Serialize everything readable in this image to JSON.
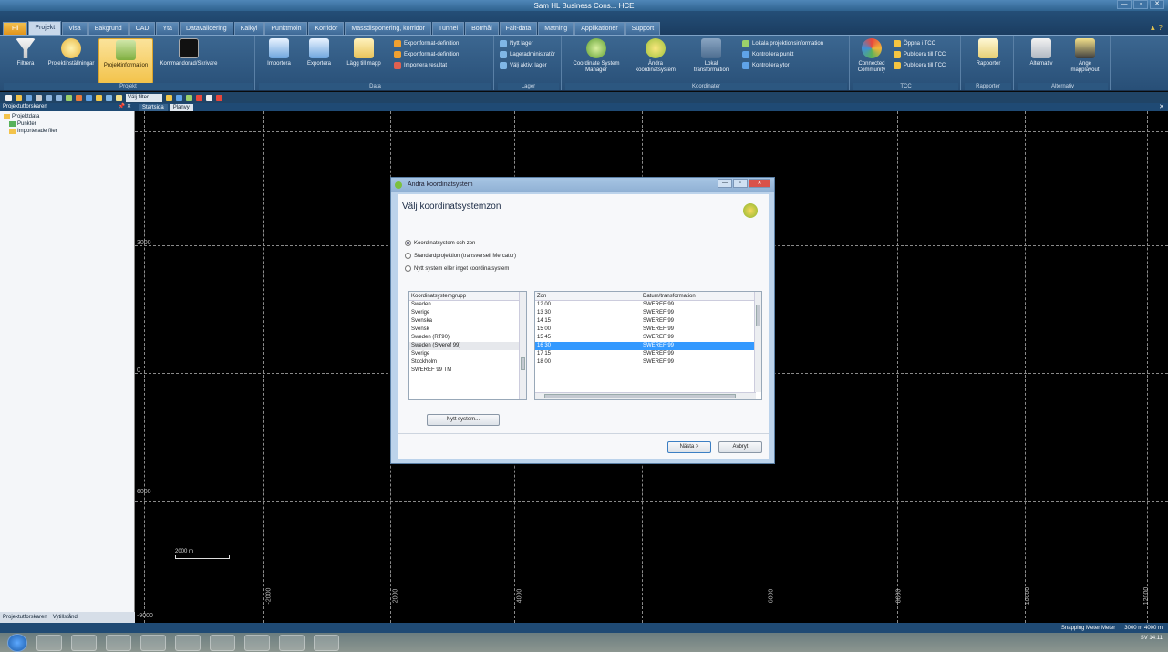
{
  "window": {
    "title": "Sam HL  Business Cons...  HCE",
    "minimize": "—",
    "maximize": "▫",
    "close": "✕"
  },
  "tabs": [
    "Fil",
    "Projekt",
    "Visa",
    "Bakgrund",
    "CAD",
    "Yta",
    "Datavalidering",
    "Kalkyl",
    "Punktmoln",
    "Korridor",
    "Massdisponering, korridor",
    "Tunnel",
    "Borrhål",
    "Fält-data",
    "Mätning",
    "Applikationer",
    "Support"
  ],
  "tabs_right": "▲  ?",
  "ribbon": {
    "groups": [
      {
        "label": "Projekt",
        "big": [
          "Filtrera",
          "Projektinställningar",
          "Projektinformation",
          "Kommandorad/Skrivare"
        ]
      },
      {
        "label": "Data",
        "big": [
          "Importera",
          "Exportera",
          "Lägg till mapp"
        ],
        "small": [
          "Exportformat-definition",
          "Exportformat-definition",
          "Importera resultat"
        ]
      },
      {
        "label": "Lager",
        "small": [
          "Nytt lager",
          "Lageradministratör",
          "Välj aktivt lager"
        ]
      },
      {
        "label": "Koordinater",
        "big": [
          "Coordinate System Manager",
          "Ändra koordinatsystem",
          "Lokal transformation"
        ],
        "small": [
          "Lokala projektionsinformation",
          "Kontrollera punkt",
          "Kontrollera ytor"
        ]
      },
      {
        "label": "TCC",
        "big": [
          "Connected Community"
        ],
        "small": [
          "Öppna i TCC",
          "Publicera till TCC",
          "Publicera till TCC"
        ]
      },
      {
        "label": "Rapporter",
        "big": [
          "Rapporter"
        ]
      },
      {
        "label": "Alternativ",
        "big": [
          "Alternativ",
          "Ange mapplayout"
        ]
      }
    ]
  },
  "qat": {
    "filter_label": "Välj filter"
  },
  "left_panel": {
    "title": "Projektutforskaren",
    "pin": "📌 ✕",
    "tree": [
      "Projektdata",
      "Punkter",
      "Importerade filer"
    ],
    "bottom_tabs": [
      "Projektutforskaren",
      "Vytillstånd"
    ]
  },
  "doc_tabs": [
    "Startsida",
    "Planvy"
  ],
  "canvas": {
    "y_labels": [
      "3000",
      "0",
      "6000",
      "-9000"
    ],
    "x_labels": [
      "-2000",
      "2000",
      "4000",
      "6000",
      "8000",
      "10000",
      "12000"
    ],
    "scale_text": "2000 m"
  },
  "status_bar": {
    "view": "Snapping  Meter  Meter",
    "coords": "3000 m  4000 m"
  },
  "taskbar": {
    "lang": "SV",
    "time": "14:11"
  },
  "dialog": {
    "title": "Ändra koordinatsystem",
    "heading": "Välj koordinatsystemzon",
    "radios": [
      {
        "label": "Koordinatsystem och zon",
        "selected": true
      },
      {
        "label": "Standardprojektion (transversell Mercator)",
        "selected": false
      },
      {
        "label": "Nytt system eller inget koordinatsystem",
        "selected": false
      }
    ],
    "left_list": {
      "header": "Koordinatsystemgrupp",
      "items": [
        "Sweden",
        "Sverige",
        "Svenska",
        "Svensk",
        "Sweden (RT90)",
        "Sweden (Sweref 99)",
        "Sverige",
        "Stockholm",
        "SWEREF 99 TM"
      ],
      "selected_index": 5
    },
    "right_list": {
      "headers": [
        "Zon",
        "Datum/transformation"
      ],
      "rows": [
        [
          "12 00",
          "SWEREF 99"
        ],
        [
          "13 30",
          "SWEREF 99"
        ],
        [
          "14 15",
          "SWEREF 99"
        ],
        [
          "15 00",
          "SWEREF 99"
        ],
        [
          "15 45",
          "SWEREF 99"
        ],
        [
          "16 30",
          "SWEREF 99"
        ],
        [
          "17 15",
          "SWEREF 99"
        ],
        [
          "18 00",
          "SWEREF 99"
        ]
      ],
      "selected_index": 5
    },
    "new_system_button": "Nytt system...",
    "next_button": "Nästa >",
    "cancel_button": "Avbryt"
  }
}
